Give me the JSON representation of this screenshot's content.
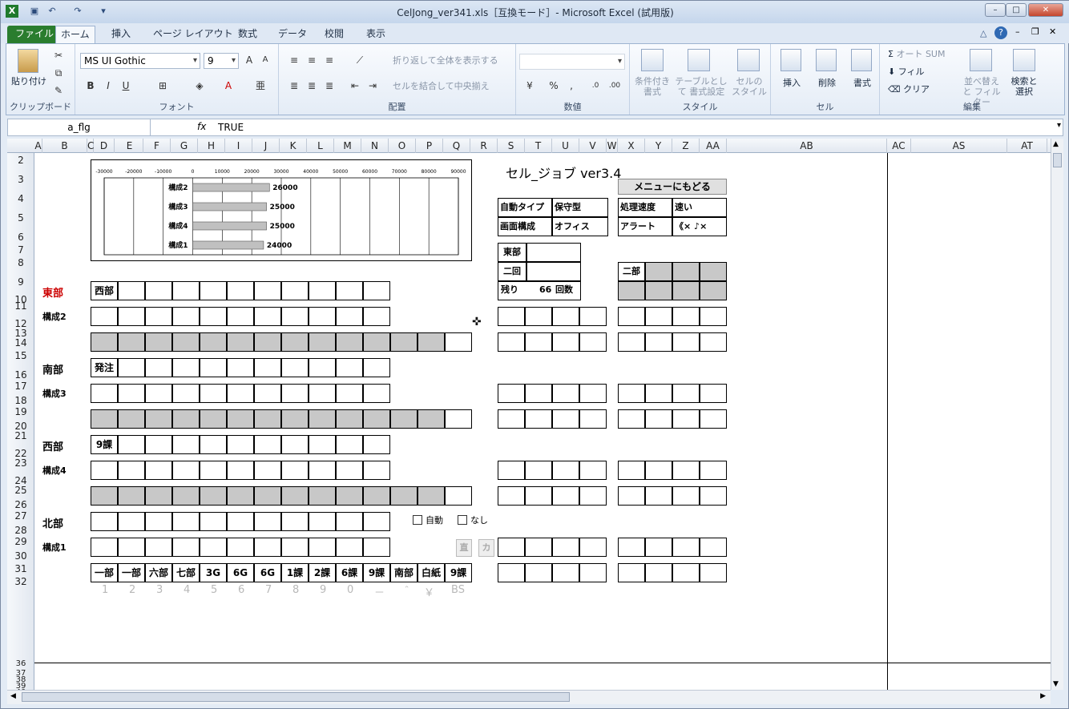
{
  "window": {
    "title": "CelJong_ver341.xls［互換モード］- Microsoft Excel (試用版)"
  },
  "tabs": [
    "ファイル",
    "ホーム",
    "挿入",
    "ページ レイアウト",
    "数式",
    "データ",
    "校閲",
    "表示"
  ],
  "ribbon": {
    "clipboard": {
      "paste": "貼り付け",
      "label": "クリップボード"
    },
    "font": {
      "name": "MS UI Gothic",
      "size": "9",
      "label": "フォント"
    },
    "align": {
      "wrap": "折り返して全体を表示する",
      "merge": "セルを結合して中央揃え",
      "label": "配置"
    },
    "number": {
      "label": "数値"
    },
    "style": {
      "cond": "条件付き 書式",
      "table": "テーブルとして 書式設定",
      "cell": "セルの スタイル",
      "label": "スタイル"
    },
    "cells": {
      "insert": "挿入",
      "delete": "削除",
      "format": "書式",
      "label": "セル"
    },
    "edit": {
      "autosum": "オート SUM",
      "fill": "フィル",
      "clear": "クリア",
      "sort": "並べ替えと フィルター",
      "find": "検索と 選択",
      "label": "編集"
    }
  },
  "formula": {
    "name": "a_flg",
    "fx": "fx",
    "value": "TRUE"
  },
  "columns": [
    "A",
    "B",
    "C",
    "D",
    "E",
    "F",
    "G",
    "H",
    "I",
    "J",
    "K",
    "L",
    "M",
    "N",
    "O",
    "P",
    "Q",
    "R",
    "S",
    "T",
    "U",
    "V",
    "W",
    "X",
    "Y",
    "Z",
    "AA",
    "AB",
    "AC",
    "AS",
    "AT"
  ],
  "rows": [
    "2",
    "3",
    "4",
    "5",
    "6",
    "7",
    "8",
    "9",
    "10",
    "11",
    "12",
    "13",
    "14",
    "15",
    "16",
    "17",
    "18",
    "19",
    "20",
    "21",
    "22",
    "23",
    "24",
    "25",
    "26",
    "27",
    "28",
    "29",
    "30",
    "31",
    "32",
    "36",
    "37",
    "38",
    "39",
    "40"
  ],
  "sheet": {
    "title": "セル_ジョブ ver3.4",
    "menu_btn": "メニューにもどる",
    "auto_type": "自動タイプ",
    "auto_val": "保守型",
    "speed": "処理速度",
    "speed_val": "速い",
    "screen": "画面構成",
    "screen_val": "オフィス",
    "alert": "アラート",
    "alert_val": "《× ♪×",
    "wind": "東部",
    "round": "二回",
    "remain": "残り",
    "remain_n": "66",
    "remain_u": "回数",
    "dora": "二部",
    "players": [
      "東部",
      "南部",
      "西部",
      "北部"
    ],
    "configs": [
      "構成2",
      "構成3",
      "構成4",
      "構成1"
    ],
    "first_cells": [
      "西部",
      "発注",
      "9課",
      ""
    ],
    "check_auto": "自動",
    "check_none": "なし",
    "btn_a": "直",
    "btn_b": "カ",
    "bottom": [
      "一部",
      "一部",
      "六部",
      "七部",
      "3G",
      "6G",
      "6G",
      "1課",
      "2課",
      "6課",
      "9課",
      "南部",
      "白紙",
      "9課"
    ],
    "keys": [
      "1",
      "2",
      "3",
      "4",
      "5",
      "6",
      "7",
      "8",
      "9",
      "0",
      "－",
      "＾",
      "￥",
      "BS"
    ]
  },
  "chart_data": {
    "type": "bar",
    "categories": [
      "構成2",
      "構成3",
      "構成4",
      "構成1"
    ],
    "values": [
      26000,
      25000,
      25000,
      24000
    ],
    "labels": [
      "26000",
      "25000",
      "25000",
      "24000"
    ],
    "ticks": [
      "-30000",
      "-20000",
      "-10000",
      "0",
      "10000",
      "20000",
      "30000",
      "40000",
      "50000",
      "60000",
      "70000",
      "80000",
      "90000"
    ],
    "xlim": [
      -30000,
      90000
    ]
  }
}
